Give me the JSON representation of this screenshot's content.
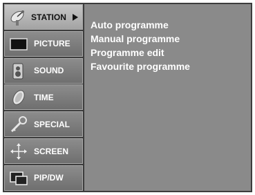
{
  "menu": {
    "items": [
      {
        "label": "STATION",
        "icon": "satellite-dish-icon",
        "active": true
      },
      {
        "label": "PICTURE",
        "icon": "tv-screen-icon",
        "active": false
      },
      {
        "label": "SOUND",
        "icon": "speaker-icon",
        "active": false
      },
      {
        "label": "TIME",
        "icon": "clock-icon",
        "active": false
      },
      {
        "label": "SPECIAL",
        "icon": "key-icon",
        "active": false
      },
      {
        "label": "SCREEN",
        "icon": "move-arrows-icon",
        "active": false
      },
      {
        "label": "PIP/DW",
        "icon": "pip-icon",
        "active": false
      }
    ]
  },
  "submenu": {
    "items": [
      "Auto programme",
      "Manual programme",
      "Programme edit",
      "Favourite programme"
    ]
  },
  "colors": {
    "background": "#3c3c3c",
    "panel": "#8a8a8a",
    "active_tab": "#b5b5b5",
    "text": "#ffffff"
  }
}
